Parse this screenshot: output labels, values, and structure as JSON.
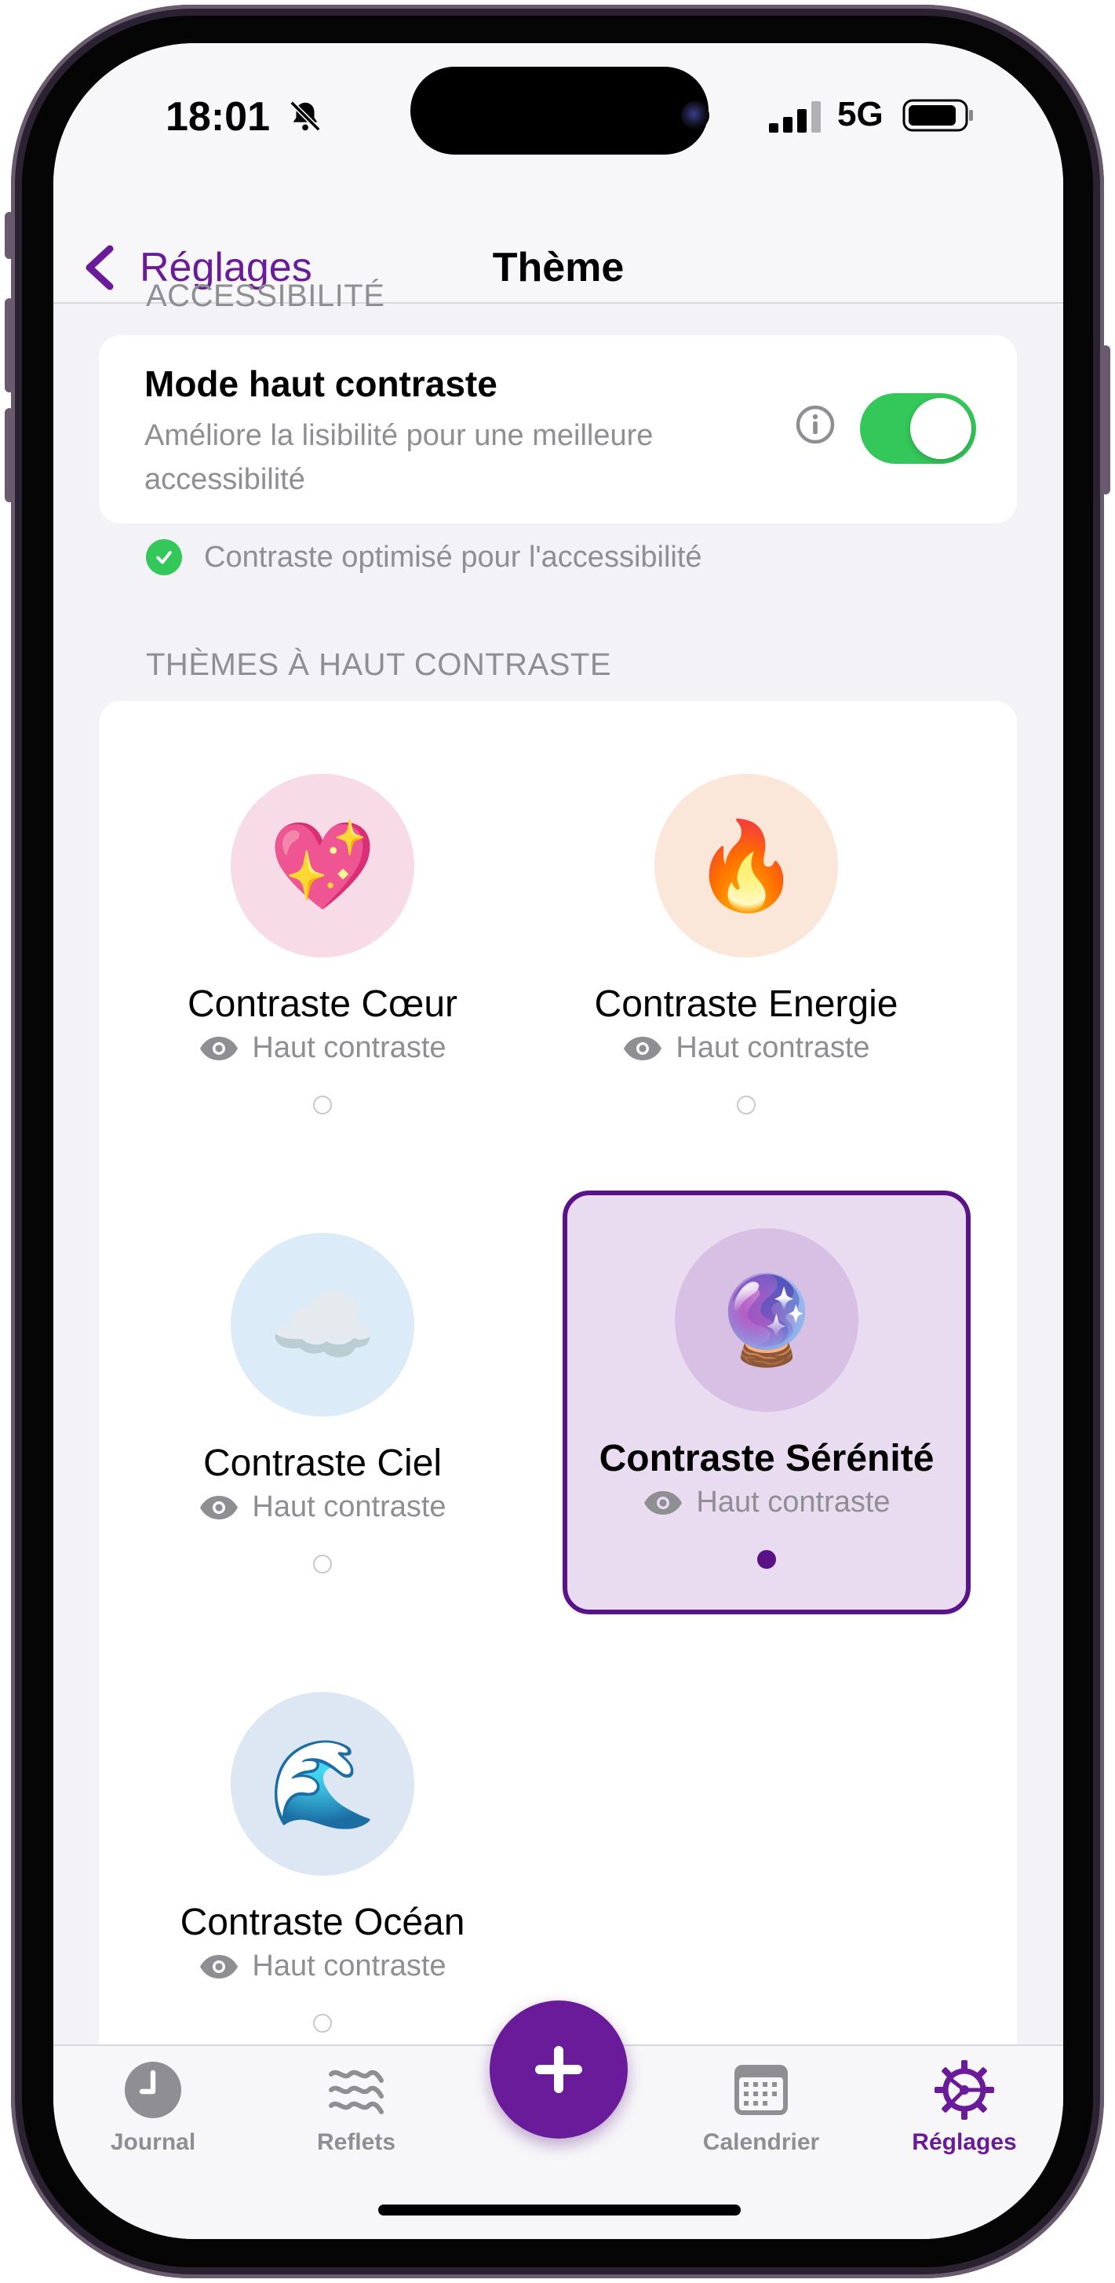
{
  "status_bar": {
    "time": "18:01",
    "network": "5G"
  },
  "nav": {
    "back_label": "Réglages",
    "title": "Thème"
  },
  "accessibility": {
    "section_header": "ACCESSIBILITÉ",
    "high_contrast_title": "Mode haut contraste",
    "high_contrast_desc": "Améliore la lisibilité pour une meilleure accessibilité",
    "toggle_on": true,
    "note": "Contraste optimisé pour l'accessibilité"
  },
  "themes_section": {
    "header": "THÈMES À HAUT CONTRASTE",
    "items": [
      {
        "name": "Contraste Cœur",
        "subtitle": "Haut contraste",
        "emoji": "💖",
        "circle_color": "#f7dbe6",
        "selected": false
      },
      {
        "name": "Contraste Energie",
        "subtitle": "Haut contraste",
        "emoji": "🔥",
        "circle_color": "#fbe7da",
        "selected": false
      },
      {
        "name": "Contraste Ciel",
        "subtitle": "Haut contraste",
        "emoji": "☁️",
        "circle_color": "#dcebf8",
        "selected": false
      },
      {
        "name": "Contraste Sérénité",
        "subtitle": "Haut contraste",
        "emoji": "🔮",
        "circle_color": "#d8c0e4",
        "selected": true
      },
      {
        "name": "Contraste Océan",
        "subtitle": "Haut contraste",
        "emoji": "🌊",
        "circle_color": "#dde7f3",
        "selected": false
      }
    ]
  },
  "tabbar": {
    "journal": "Journal",
    "reflets": "Reflets",
    "calendrier": "Calendrier",
    "reglages": "Réglages",
    "active": "reglages"
  },
  "colors": {
    "accent": "#6a1b9a",
    "toggle_on": "#34c759",
    "secondary_text": "#8e8e93"
  }
}
